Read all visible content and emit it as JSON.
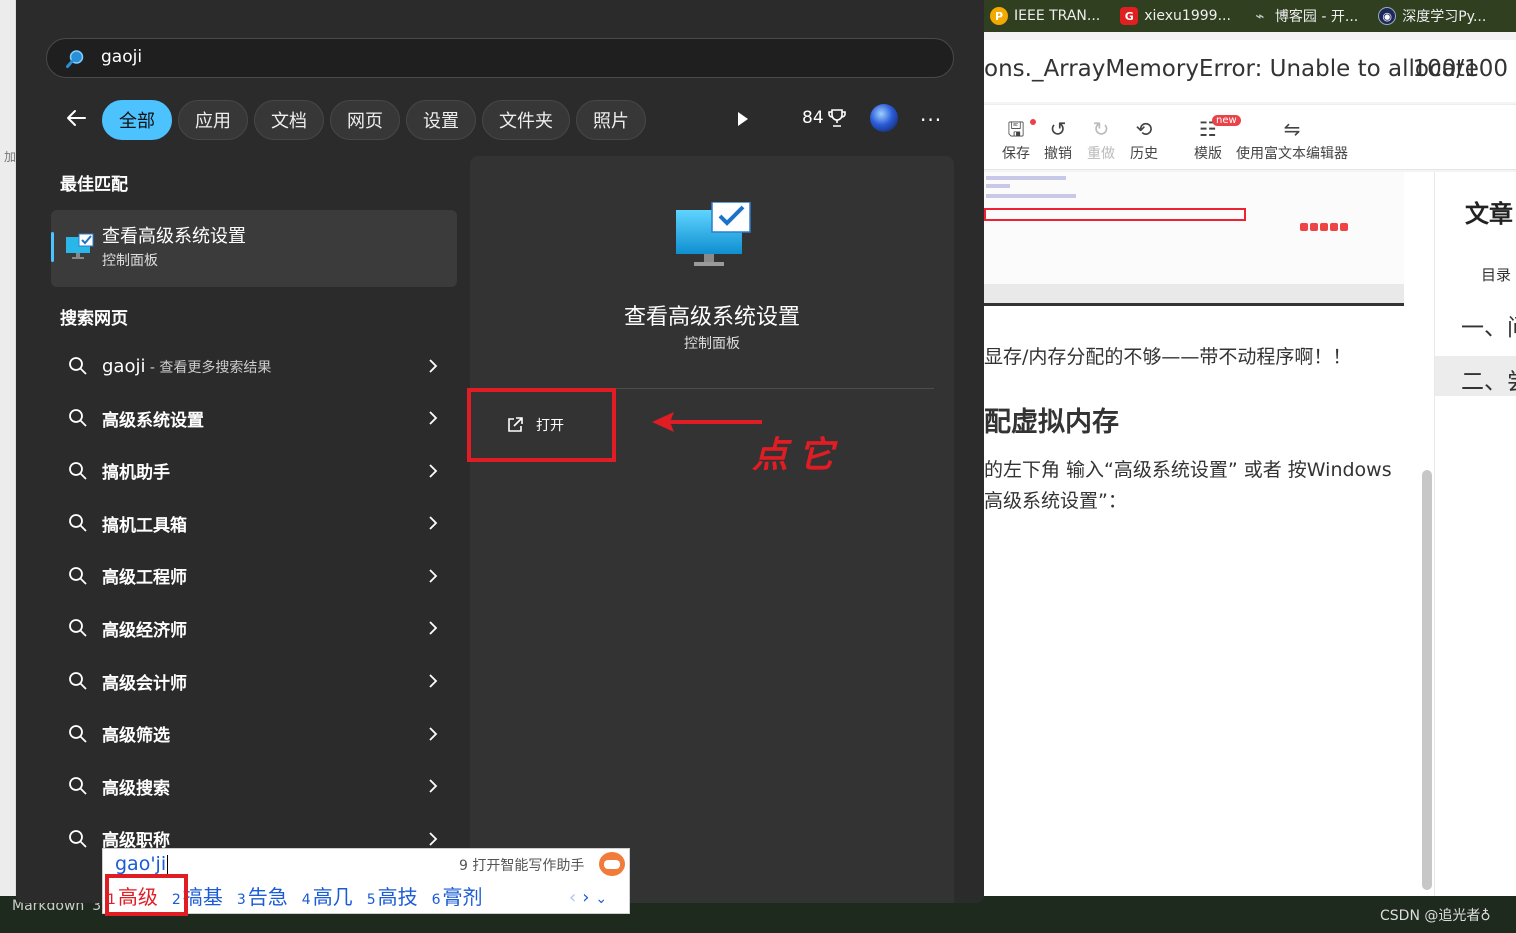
{
  "bookmarks": [
    {
      "label": "IEEE TRAN...",
      "icon": "p-circle-icon",
      "color": "#f2a900",
      "glyph": "P"
    },
    {
      "label": "xiexu1999...",
      "icon": "g-badge-icon",
      "color": "#e02020",
      "glyph": "G"
    },
    {
      "label": "博客园 - 开...",
      "icon": "cnblogs-icon",
      "color": "#555555",
      "glyph": "⌁"
    },
    {
      "label": "深度学习Py...",
      "icon": "camera-icon",
      "color": "#1b2a5a",
      "glyph": "◉"
    }
  ],
  "editor": {
    "title": "ons._ArrayMemoryError: Unable to allocate",
    "counter": "100/100",
    "toolbar": [
      "保存",
      "撤销",
      "重做",
      "历史",
      "模版",
      "使用富文本编辑器"
    ],
    "new_badge": "new",
    "para1": "显存/内存分配的不够——带不动程序啊！！",
    "heading": "配虚拟内存",
    "para2": "的左下角 输入“高级系统设置” 或者 按Windows",
    "para3": "高级系统设置”：",
    "left_label": "加",
    "bottom_mode": "Markdown",
    "bottom_num": "3",
    "watermark": "CSDN @追光者♁"
  },
  "toc": {
    "title": "文章目",
    "label": "目录",
    "item1": "一、问",
    "item2": "二、尝"
  },
  "search": {
    "query": "gaoji",
    "tabs": [
      "全部",
      "应用",
      "文档",
      "网页",
      "设置",
      "文件夹",
      "照片"
    ],
    "points": "84",
    "best_match_header": "最佳匹配",
    "best_match": {
      "title": "查看高级系统设置",
      "subtitle": "控制面板"
    },
    "web_header": "搜索网页",
    "web_first": {
      "term": "gaoji",
      "suffix": " - 查看更多搜索结果"
    },
    "web_results": [
      "高级系统设置",
      "搞机助手",
      "搞机工具箱",
      "高级工程师",
      "高级经济师",
      "高级会计师",
      "高级筛选",
      "高级搜索",
      "高级职称"
    ],
    "detail": {
      "title": "查看高级系统设置",
      "subtitle": "控制面板",
      "open": "打开"
    }
  },
  "annotation": {
    "note": "点它",
    "color": "#e01c24"
  },
  "ime": {
    "composition": "gao'ji",
    "hint": "9 打开智能写作助手",
    "candidates": [
      {
        "n": "1",
        "text": "高级"
      },
      {
        "n": "2",
        "text": "搞基"
      },
      {
        "n": "3",
        "text": "告急"
      },
      {
        "n": "4",
        "text": "高几"
      },
      {
        "n": "5",
        "text": "高技"
      },
      {
        "n": "6",
        "text": "膏剂"
      }
    ]
  },
  "colors": {
    "accent": "#4cc2ff",
    "panel": "#2b2b2b",
    "annotation": "#e01c24",
    "ime_text": "#1a5bd6"
  }
}
